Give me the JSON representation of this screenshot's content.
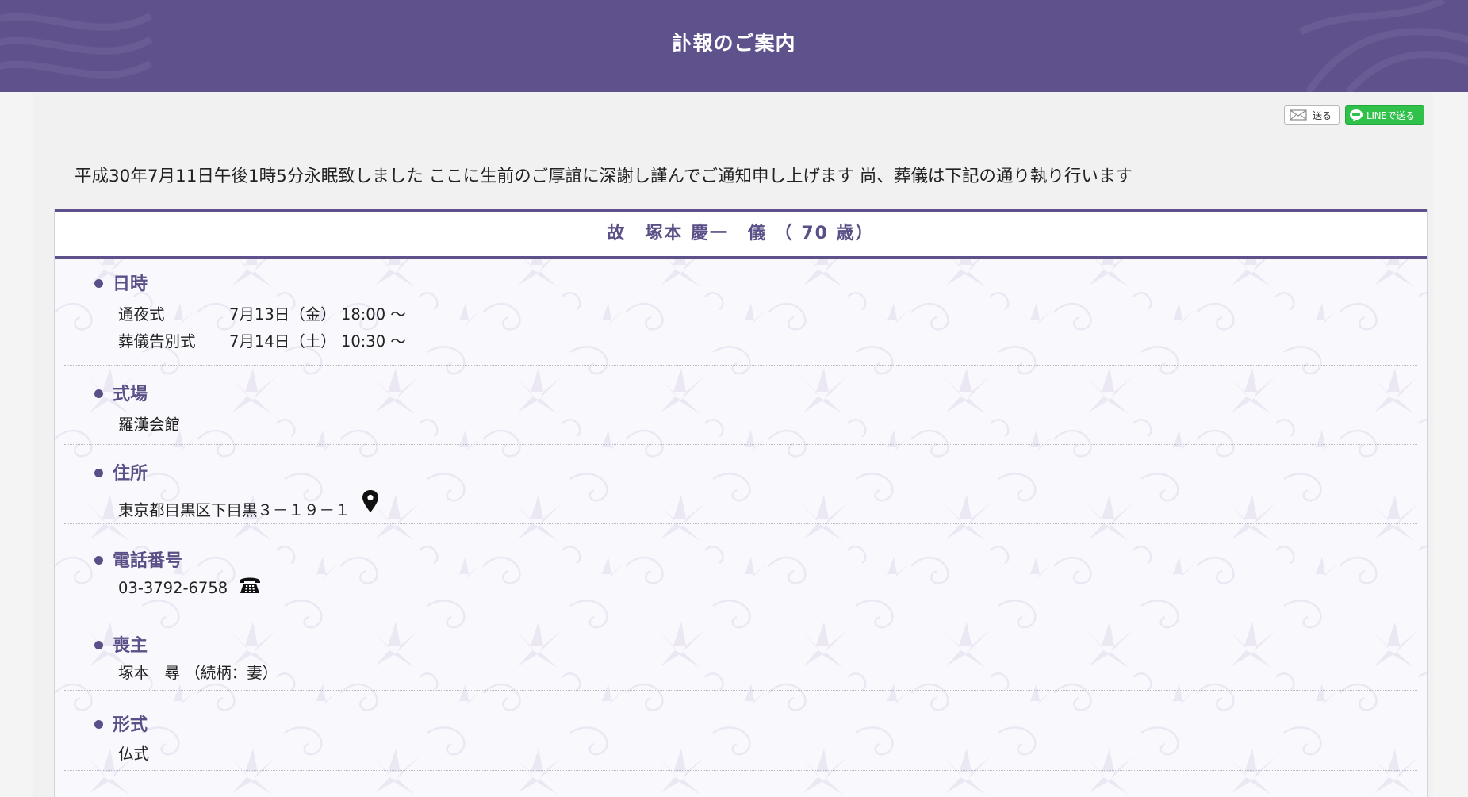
{
  "header": {
    "title": "訃報のご案内"
  },
  "share": {
    "mail_label": "送る",
    "line_label": "LINEで送る"
  },
  "intro": "平成30年7月11日午後1時5分永眠致しました ここに生前のご厚誼に深謝し謹んでご通知申し上げます 尚、葬儀は下記の通り執り行います",
  "deceased": {
    "title": "故　塚本 慶一　儀 （ 70 歳）"
  },
  "sections": {
    "datetime": {
      "heading": "日時",
      "rows": [
        {
          "label": "通夜式",
          "value": "7月13日（金） 18:00 ～"
        },
        {
          "label": "葬儀告別式",
          "value": "7月14日（土） 10:30 ～"
        }
      ]
    },
    "venue": {
      "heading": "式場",
      "value": "羅漢会館"
    },
    "address": {
      "heading": "住所",
      "value": "東京都目黒区下目黒３－１９－１",
      "icon": "map-pin-icon"
    },
    "phone": {
      "heading": "電話番号",
      "value": "03-3792-6758",
      "icon": "telephone-icon"
    },
    "chief_mourner": {
      "heading": "喪主",
      "value": "塚本　尋 （続柄：妻）"
    },
    "format": {
      "heading": "形式",
      "value": "仏式"
    }
  },
  "colors": {
    "header_bg": "#5f528c",
    "accent": "#5a4f87",
    "line_green": "#2fc14a"
  }
}
